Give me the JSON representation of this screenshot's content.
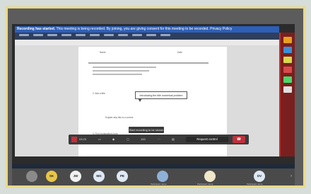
{
  "recording_banner": {
    "title": "Recording has started.",
    "text": "This meeting is being recorded. By joining, you are giving consent for this meeting to be recorded. Privacy Policy"
  },
  "document": {
    "header_left": "Name",
    "header_right": "Date",
    "question_2": "2. Add a title.",
    "callout_text": "Introducing the title numerical problem",
    "line_explain": "Explain why this is a correct",
    "line_3": "3. Find explanations here"
  },
  "meeting": {
    "tooltip": "Start recording to be shown",
    "timer": "03:23",
    "zoom_value": "100",
    "request_control_label": "Request control",
    "end_icon": "phone-hangup-icon"
  },
  "participants": [
    {
      "initials": "SK",
      "color": "#e8c64a",
      "name": ""
    },
    {
      "initials": "JW",
      "color": "#f1f1f1",
      "name": ""
    },
    {
      "initials": "MG",
      "color": "#dfe8f5",
      "name": ""
    },
    {
      "initials": "PE",
      "color": "#dfe8f5",
      "name": ""
    },
    {
      "initials": "",
      "color": "#8fb1d6",
      "name": "Participant name"
    },
    {
      "initials": "",
      "color": "#f0e6c8",
      "name": "Participant name"
    },
    {
      "initials": "DV",
      "color": "#dfe8f5",
      "name": "Participant name"
    }
  ],
  "colors": {
    "accent": "#2d5fb8",
    "end_call": "#c0303a",
    "frame": "#e8d98a"
  }
}
